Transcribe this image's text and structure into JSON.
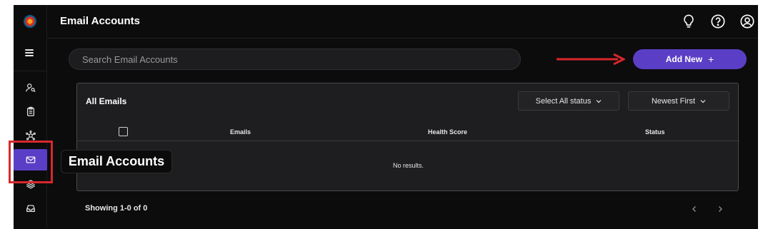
{
  "app": {
    "logo_icon": "app-logo-icon"
  },
  "header": {
    "title": "Email Accounts",
    "icons": [
      "lightbulb-icon",
      "help-icon",
      "user-account-icon"
    ]
  },
  "sidebar": {
    "menu_icon": "hamburger-menu-icon",
    "items": [
      {
        "icon": "user-search-icon",
        "active": false
      },
      {
        "icon": "clipboard-icon",
        "active": false
      },
      {
        "icon": "network-icon",
        "active": false
      },
      {
        "icon": "mail-icon",
        "active": true
      },
      {
        "icon": "layers-icon",
        "active": false
      },
      {
        "icon": "inbox-icon",
        "active": false
      }
    ]
  },
  "search": {
    "placeholder": "Search Email Accounts",
    "value": ""
  },
  "add_button": {
    "label": "Add New",
    "plus": "+"
  },
  "card": {
    "title": "All Emails",
    "status_filter": "Select All status",
    "sort": "Newest First",
    "columns": [
      "Emails",
      "Health Score",
      "Status"
    ],
    "empty_text": "No results."
  },
  "footer": {
    "showing": "Showing 1-0 of 0"
  },
  "annotation": {
    "tooltip": "Email Accounts"
  },
  "colors": {
    "accent": "#5a3fc6",
    "highlight": "#d8282b",
    "background": "#0c0c0d",
    "card": "#1e1e20"
  }
}
